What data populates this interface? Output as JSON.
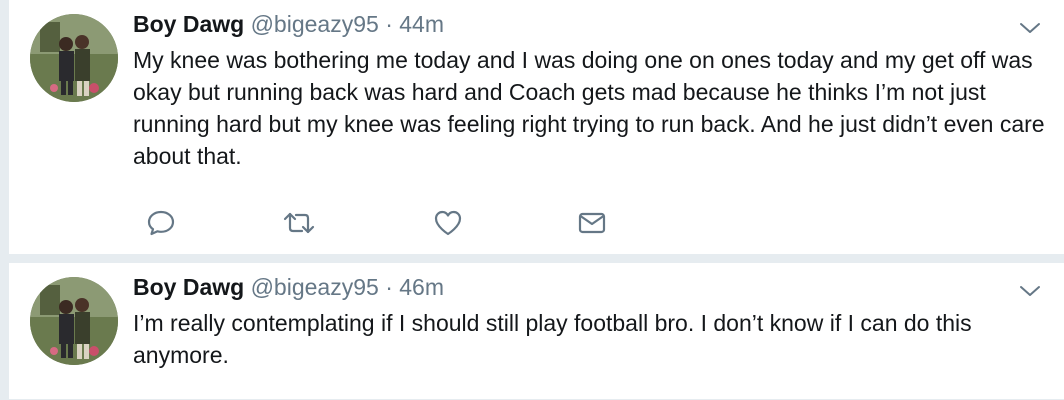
{
  "tweets": [
    {
      "name": "Boy Dawg",
      "handle": "@bigeazy95",
      "separator": "·",
      "time": "44m",
      "text": "My knee was bothering me today and I was doing one on ones today and my get off was okay but running back was hard and Coach gets mad because he thinks I’m not just running hard but my knee was feeling right trying to run back. And he just didn’t even care about that.",
      "actions": [
        "reply-icon",
        "retweet-icon",
        "like-icon",
        "dm-icon"
      ]
    },
    {
      "name": "Boy Dawg",
      "handle": "@bigeazy95",
      "separator": "·",
      "time": "46m",
      "text": "I’m really contemplating if I should still play football bro. I don’t know if I can do this anymore."
    }
  ],
  "colors": {
    "background": "#e6ecf0",
    "card": "#ffffff",
    "text": "#14171a",
    "muted": "#657786"
  }
}
